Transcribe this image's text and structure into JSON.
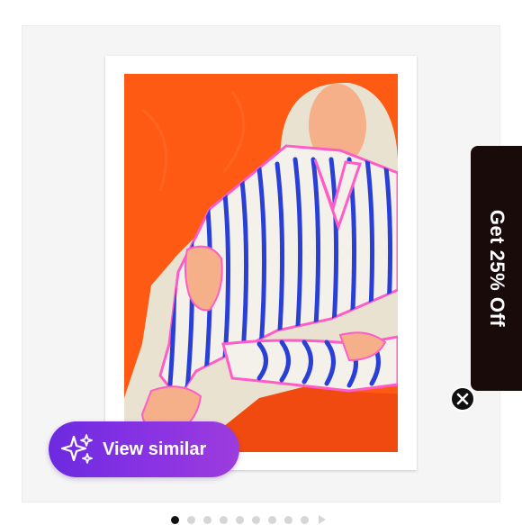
{
  "product_image": {
    "artwork": "orange-figure-striped-suit",
    "background_color": "#ff5a14",
    "mat_color": "#ffffff"
  },
  "view_similar": {
    "label": "View similar",
    "icon": "sparkle-icon",
    "gradient_start": "#6c2ae0",
    "gradient_end": "#9c3cdd"
  },
  "promo": {
    "text": "Get 25% Off",
    "background": "#1a0b0b",
    "close_icon": "close-icon"
  },
  "carousel": {
    "total": 9,
    "active_index": 0,
    "next_icon": "chevron-right-icon"
  }
}
